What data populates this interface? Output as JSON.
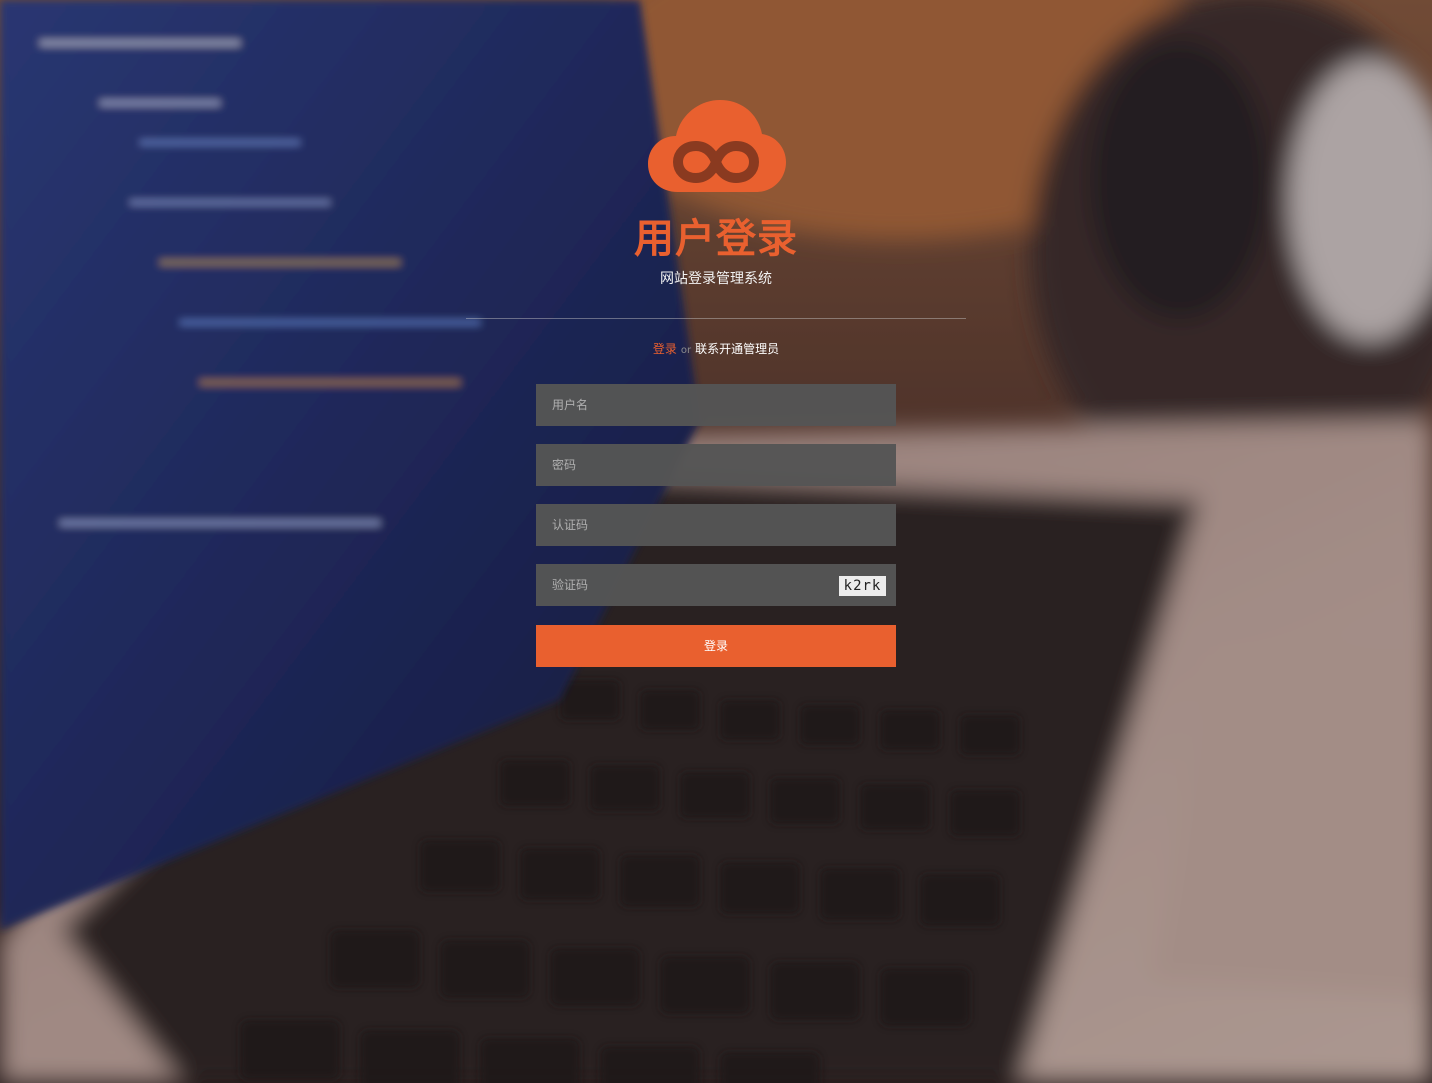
{
  "header": {
    "title": "用户登录",
    "subtitle": "网站登录管理系统"
  },
  "switch": {
    "login_label": "登录",
    "or_label": "or",
    "contact_label": "联系开通管理员"
  },
  "form": {
    "username_placeholder": "用户名",
    "username_value": "",
    "password_placeholder": "密码",
    "password_value": "",
    "auth_code_placeholder": "认证码",
    "auth_code_value": "",
    "captcha_placeholder": "验证码",
    "captcha_value": "",
    "captcha_image_text": "k2rk",
    "submit_label": "登录"
  },
  "colors": {
    "accent": "#e9602f",
    "input_bg": "#555555"
  },
  "icons": {
    "logo": "cloud-infinity-icon"
  }
}
